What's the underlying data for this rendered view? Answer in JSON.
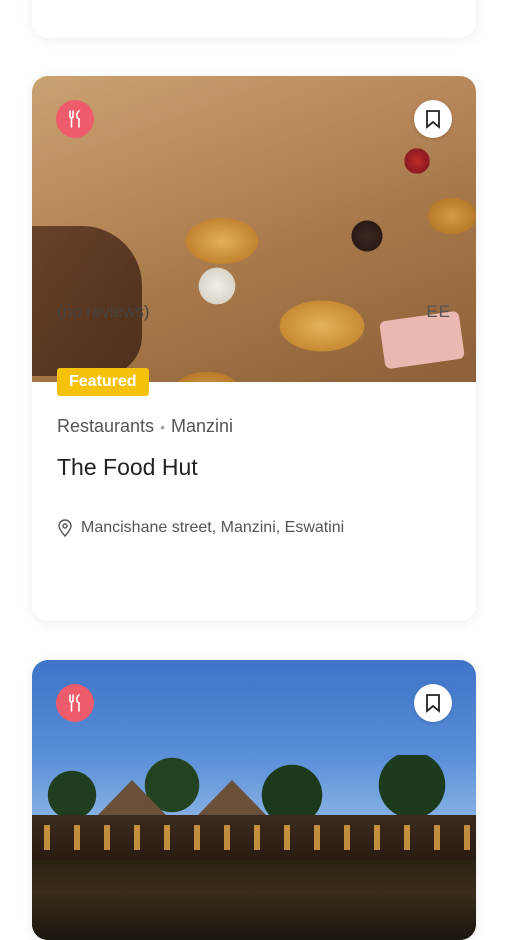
{
  "listings": [
    {
      "featured_label": "Featured",
      "category": "Restaurants",
      "location": "Manzini",
      "name": "The Food Hut",
      "address": "Mancishane street, Manzini, Eswatini",
      "reviews": "(no reviews)",
      "price": "EE",
      "category_icon": "utensils-icon",
      "bookmark_icon": "bookmark-icon"
    },
    {
      "category_icon": "utensils-icon",
      "bookmark_icon": "bookmark-icon"
    }
  ],
  "colors": {
    "category_badge": "#ee5b6b",
    "featured_badge": "#f5c10a"
  }
}
